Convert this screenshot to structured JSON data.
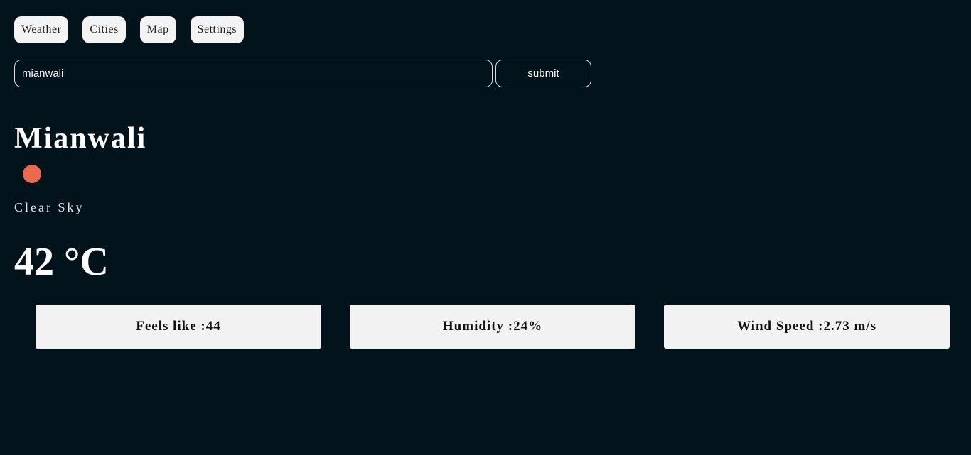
{
  "nav": {
    "items": [
      {
        "label": "Weather"
      },
      {
        "label": "Cities"
      },
      {
        "label": "Map"
      },
      {
        "label": "Settings"
      }
    ]
  },
  "search": {
    "value": "mianwali",
    "submit_label": "submit"
  },
  "weather": {
    "city": "Mianwali",
    "icon": "sun-icon",
    "icon_color": "#e96a4f",
    "condition": "Clear Sky",
    "temperature": "42 °C"
  },
  "stats": [
    {
      "label": "Feels like :44"
    },
    {
      "label": "Humidity :24%"
    },
    {
      "label": "Wind Speed :2.73 m/s"
    }
  ],
  "colors": {
    "background": "#03131c",
    "card_background": "#f2f2f2"
  }
}
